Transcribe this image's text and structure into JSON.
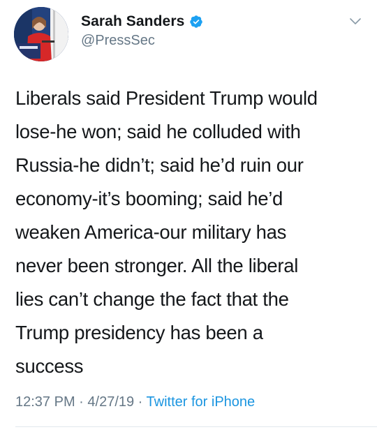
{
  "user": {
    "display_name": "Sarah Sanders",
    "handle": "@PressSec",
    "verified": true,
    "avatar_icon": "profile-photo-icon",
    "verified_icon": "verified-badge-icon"
  },
  "menu": {
    "icon": "chevron-down-icon"
  },
  "tweet": {
    "lines": [
      "Liberals said President Trump would",
      "lose-he won; said he colluded with",
      "Russia-he didn’t; said he’d ruin our",
      "economy-it’s booming; said he’d",
      "weaken America-our military has",
      "never been stronger. All the liberal",
      "lies can’t change the fact that the",
      "Trump presidency has been a",
      "success"
    ]
  },
  "meta": {
    "time": "12:37 PM",
    "sep1": " · ",
    "date": "4/27/19",
    "sep2": " · ",
    "source": "Twitter for iPhone"
  },
  "colors": {
    "text": "#14171a",
    "secondary": "#657786",
    "link": "#1b95e0",
    "verified": "#1da1f2"
  }
}
